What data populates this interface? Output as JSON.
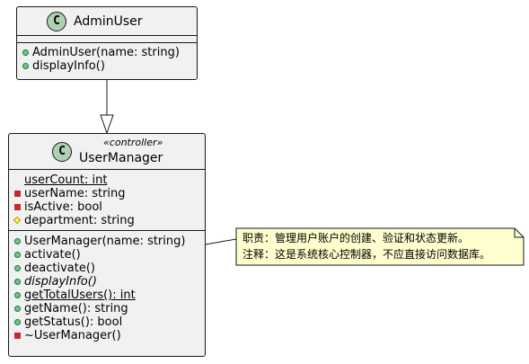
{
  "admin_user": {
    "badge": "C",
    "name": "AdminUser",
    "fields": [],
    "methods": [
      {
        "visibility": "public",
        "text": "AdminUser(name: string)"
      },
      {
        "visibility": "public",
        "text": "displayInfo()"
      }
    ]
  },
  "user_manager": {
    "badge": "C",
    "stereotype": "«controller»",
    "name": "UserManager",
    "fields": [
      {
        "visibility": "none",
        "text": "userCount: int",
        "static": true
      },
      {
        "visibility": "private",
        "text": "userName: string"
      },
      {
        "visibility": "private",
        "text": "isActive: bool"
      },
      {
        "visibility": "protected",
        "text": "department: string"
      }
    ],
    "methods": [
      {
        "visibility": "public",
        "text": "UserManager(name: string)"
      },
      {
        "visibility": "public",
        "text": "activate()"
      },
      {
        "visibility": "public",
        "text": "deactivate()"
      },
      {
        "visibility": "public",
        "text": "displayInfo()",
        "abstract": true
      },
      {
        "visibility": "public",
        "text": "getTotalUsers(): int",
        "static": true
      },
      {
        "visibility": "public",
        "text": "getName(): string"
      },
      {
        "visibility": "public",
        "text": "getStatus(): bool"
      },
      {
        "visibility": "private",
        "text": "~UserManager()"
      }
    ]
  },
  "note": {
    "lines": [
      "职责：管理用户账户的创建、验证和状态更新。",
      "注释：这是系统核心控制器，不应直接访问数据库。"
    ]
  },
  "colors": {
    "class_fill": "#f1f1f1",
    "border": "#181818",
    "badge_fill": "#add1b2",
    "note_fill": "#fefece",
    "public_mark": "#84be84",
    "private_mark": "#c82930",
    "protected_mark": "#ffff44"
  }
}
